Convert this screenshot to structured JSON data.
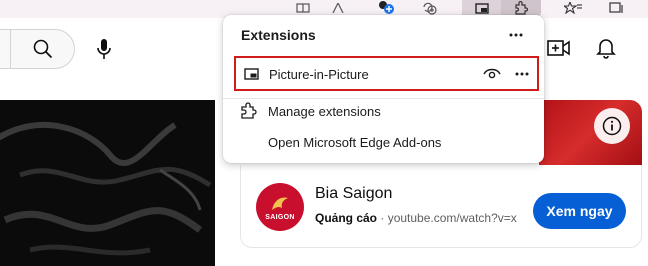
{
  "browser_toolbar": {
    "icons": [
      "split-screen-icon",
      "read-aloud-icon",
      "profile-add-icon",
      "refresh-add-icon",
      "picture-in-picture-icon",
      "extensions-icon",
      "favorites-icon",
      "collections-icon"
    ]
  },
  "youtube_header": {
    "icons": [
      "search-icon",
      "microphone-icon",
      "create-video-icon",
      "notifications-icon"
    ]
  },
  "extensions_popup": {
    "title": "Extensions",
    "items": [
      {
        "label": "Picture-in-Picture",
        "icon": "picture-in-picture-icon",
        "highlighted": true
      }
    ],
    "actions": [
      {
        "label": "Manage extensions",
        "icon": "puzzle-icon"
      },
      {
        "label": "Open Microsoft Edge Add-ons"
      }
    ]
  },
  "ad": {
    "title": "Bia Saigon",
    "sponsored_label": "Quảng cáo",
    "url": "youtube.com/watch?v=x",
    "cta": "Xem ngay",
    "logo_text": "SAIGON",
    "brand_color": "#c8102e",
    "cta_color": "#065fd4"
  },
  "colors": {
    "highlight_border": "#d11a1a",
    "toolbar_bg": "#f7f0f5"
  }
}
